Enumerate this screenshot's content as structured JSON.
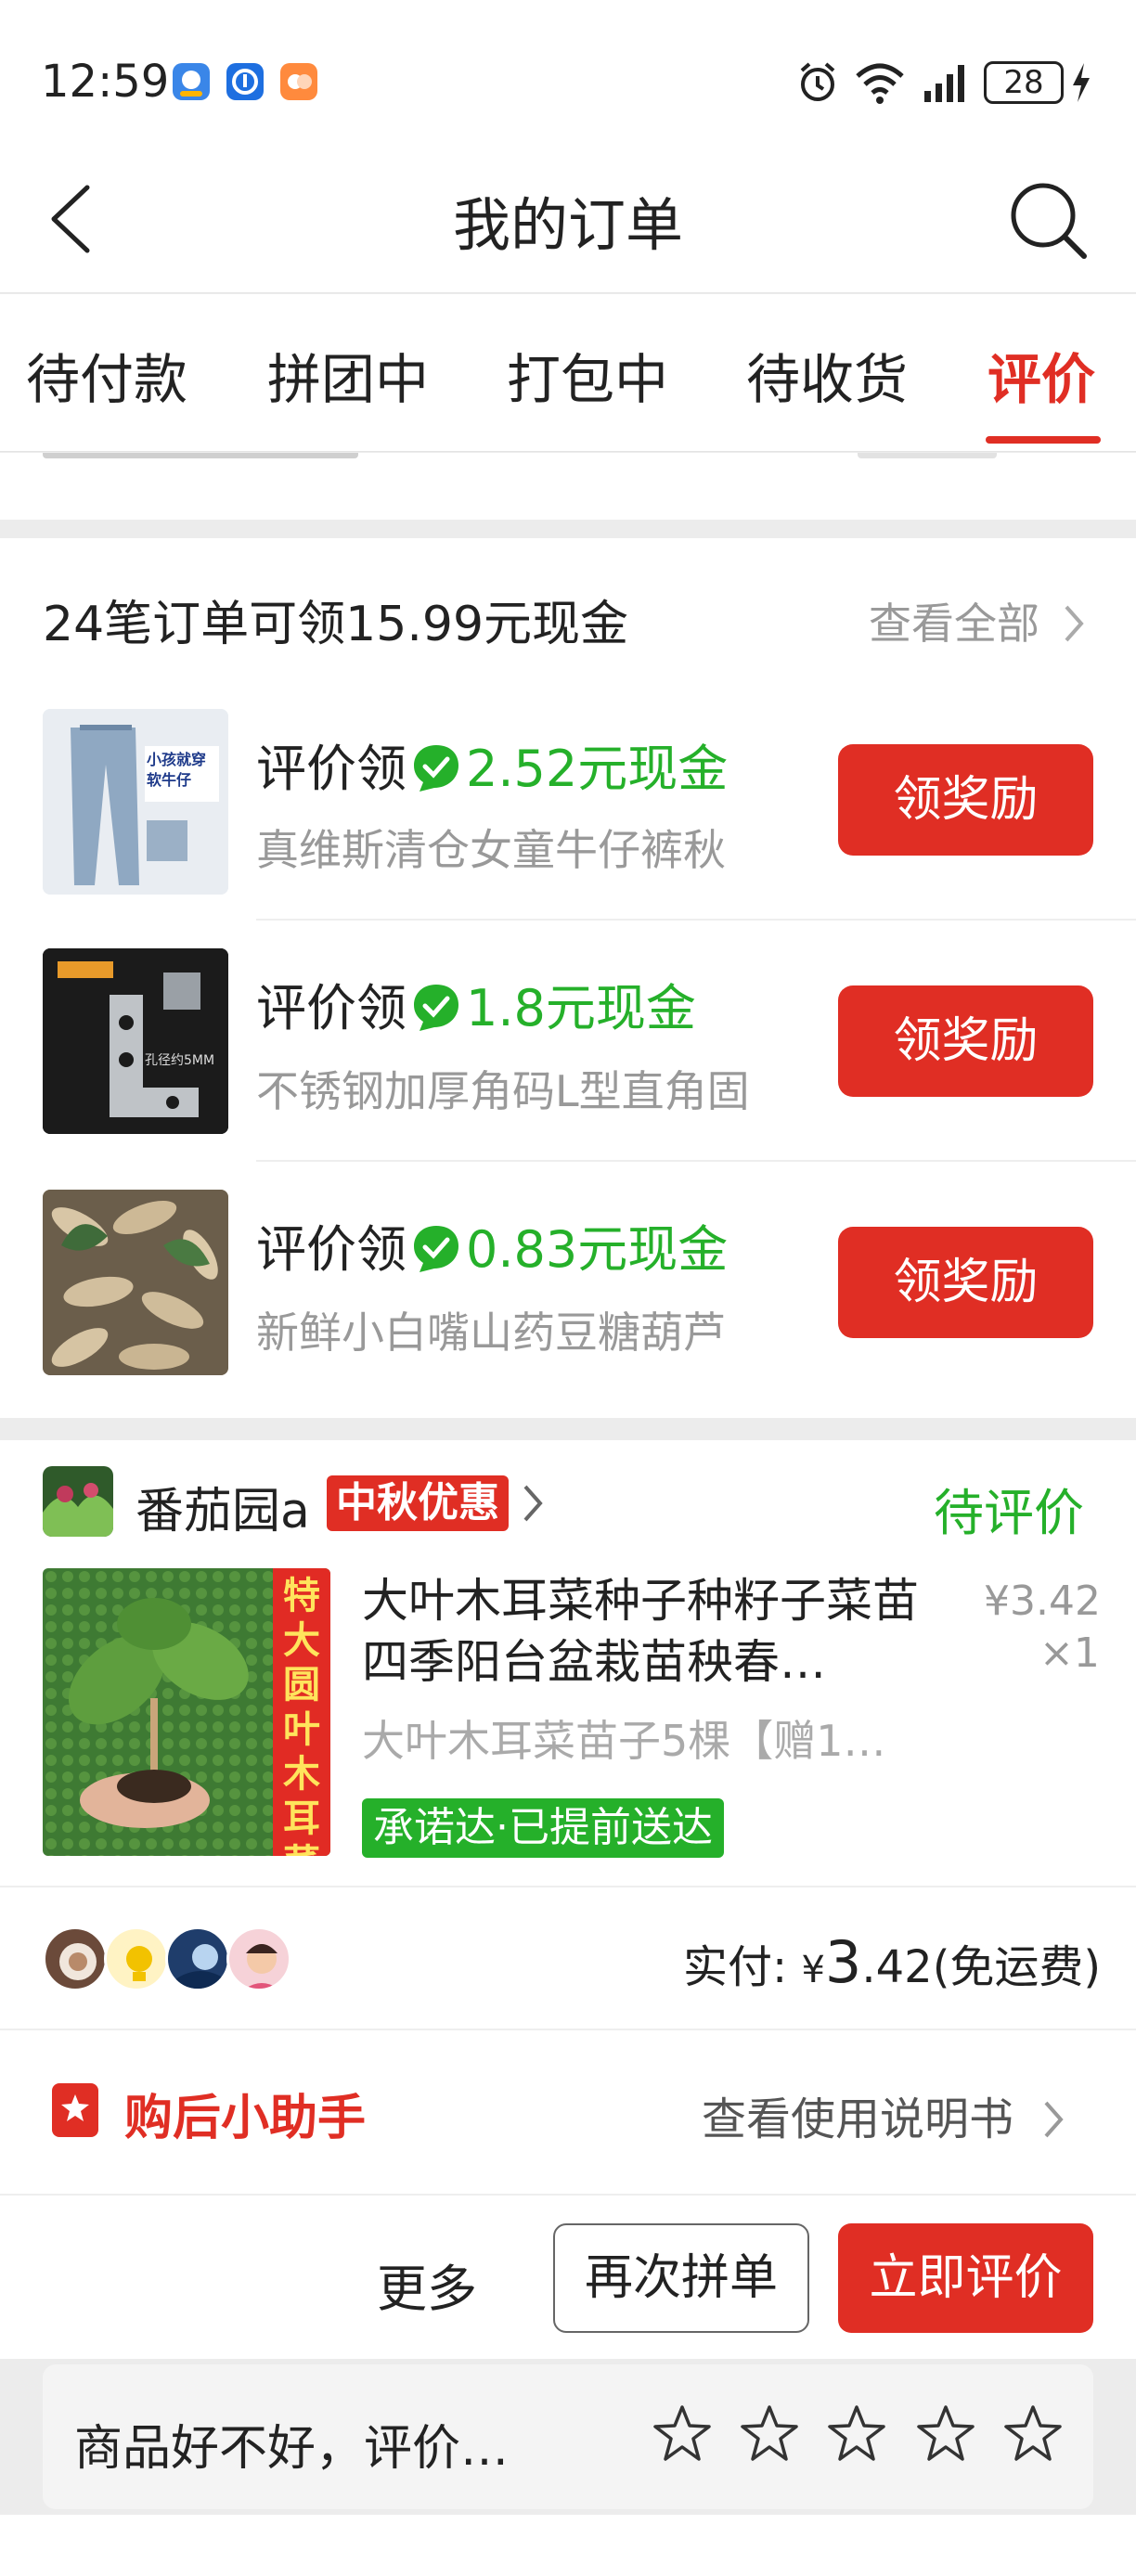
{
  "status_bar": {
    "time": "12:59",
    "battery": "28"
  },
  "header": {
    "title": "我的订单"
  },
  "tabs": [
    {
      "label": "待付款"
    },
    {
      "label": "拼团中"
    },
    {
      "label": "打包中"
    },
    {
      "label": "待收货"
    },
    {
      "label": "评价",
      "active": true
    }
  ],
  "rewards": {
    "header": "24笔订单可领15.99元现金",
    "view_all": "查看全部",
    "items": [
      {
        "prefix": "评价领",
        "amount": "2.52元现金",
        "name": "真维斯清仓女童牛仔裤秋",
        "button": "领奖励",
        "thumb_text": "小孩就穿软牛仔"
      },
      {
        "prefix": "评价领",
        "amount": "1.8元现金",
        "name": "不锈钢加厚角码L型直角固",
        "button": "领奖励",
        "thumb_text": "孔径约5MM"
      },
      {
        "prefix": "评价领",
        "amount": "0.83元现金",
        "name": "新鲜小白嘴山药豆糖葫芦",
        "button": "领奖励",
        "thumb_text": ""
      }
    ]
  },
  "order": {
    "shop_name": "番茄园a",
    "promo_badge": "中秋优惠",
    "status": "待评价",
    "product_title": "大叶木耳菜种子种籽子菜苗四季阳台盆栽苗秧春…",
    "product_spec": "大叶木耳菜苗子5棵【赠1…",
    "image_banner": "特大圆叶木耳菜苗",
    "price": "¥3.42",
    "quantity": "×1",
    "delivery_tag": "承诺达·已提前送达",
    "paid_label": "实付: ",
    "paid_currency": "¥",
    "paid_int": "3",
    "paid_dec": ".42",
    "paid_note": "(免运费)"
  },
  "assistant": {
    "label": "购后小助手",
    "link": "查看使用说明书"
  },
  "actions": {
    "more": "更多",
    "regroup": "再次拼单",
    "review": "立即评价"
  },
  "rating": {
    "prompt": "商品好不好，评价…",
    "stars": 5
  },
  "colors": {
    "accent": "#e02e24",
    "green": "#25b02a"
  }
}
